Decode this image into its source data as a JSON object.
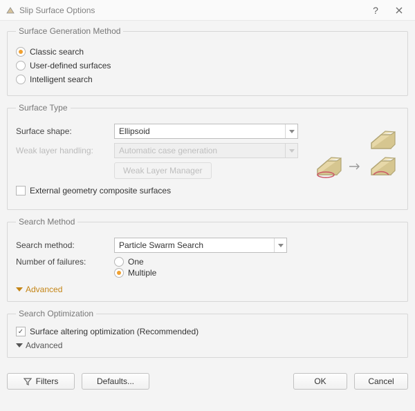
{
  "window": {
    "title": "Slip Surface Options"
  },
  "groups": {
    "generation": {
      "legend": "Surface Generation Method",
      "options": {
        "classic": "Classic search",
        "user_defined": "User-defined surfaces",
        "intelligent": "Intelligent search"
      },
      "selected": "classic"
    },
    "surface_type": {
      "legend": "Surface Type",
      "shape_label": "Surface shape:",
      "shape_value": "Ellipsoid",
      "weak_label": "Weak layer handling:",
      "weak_value": "Automatic case generation",
      "weak_button": "Weak Layer Manager",
      "external_composite": "External geometry composite surfaces",
      "external_composite_checked": false
    },
    "search_method": {
      "legend": "Search Method",
      "method_label": "Search method:",
      "method_value": "Particle Swarm Search",
      "failures_label": "Number of failures:",
      "failures_options": {
        "one": "One",
        "multiple": "Multiple"
      },
      "failures_selected": "multiple",
      "advanced_label": "Advanced"
    },
    "optimization": {
      "legend": "Search Optimization",
      "altering_label": "Surface altering optimization (Recommended)",
      "altering_checked": true,
      "advanced_label": "Advanced"
    }
  },
  "footer": {
    "filters": "Filters",
    "defaults": "Defaults...",
    "ok": "OK",
    "cancel": "Cancel"
  }
}
